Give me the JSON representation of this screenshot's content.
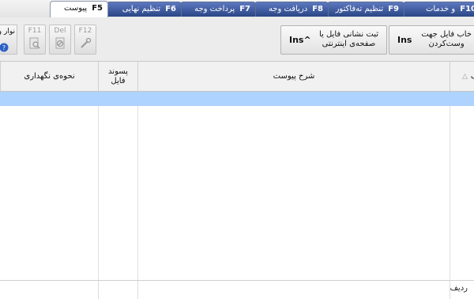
{
  "tabs": [
    {
      "key": "F10",
      "label": "و خدمات"
    },
    {
      "key": "F9",
      "label": "تنظیم ته‌فاکتور"
    },
    {
      "key": "F8",
      "label": "دریافت وجه"
    },
    {
      "key": "F7",
      "label": "پرداخت وجه"
    },
    {
      "key": "F6",
      "label": "تنظیم نهایی"
    },
    {
      "key": "F5",
      "label": "پیوست"
    }
  ],
  "toolbar": {
    "attach_button": {
      "label_line1": "خاب فایل جهت",
      "label_line2": "وست‌کردن",
      "shortcut": "Ins"
    },
    "web_button": {
      "label_line1": "ثبت نشانی فایل یا",
      "label_line2": "صفحه‌ی اینترنتی",
      "shortcut": "^Ins"
    },
    "f12_label": "F12",
    "del_label": "Del",
    "f11_label": "F11",
    "cut_label": "نوار و"
  },
  "grid": {
    "headers": {
      "row_num": "یف",
      "description": "شرح پیوست",
      "extension_line1": "پسوند",
      "extension_line2": "فایل",
      "storage": "نحوه‌ی نگهداری"
    },
    "footer_label": "ردیف"
  },
  "colors": {
    "tab_blue": "#2a4685",
    "selected_row": "#aed3ff"
  }
}
